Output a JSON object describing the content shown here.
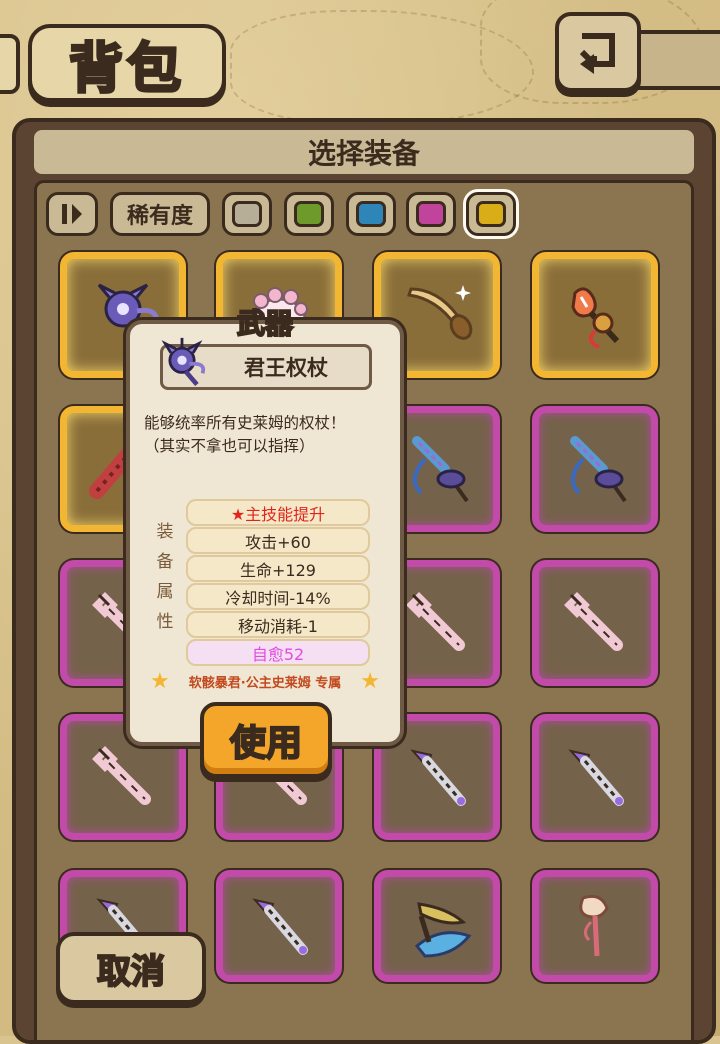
{
  "header": {
    "title": "背包"
  },
  "panel": {
    "title": "选择装备"
  },
  "filters": {
    "rarity_label": "稀有度",
    "rarity_colors": [
      "#b7ae98",
      "#6e9a2c",
      "#2e86b8",
      "#c0449b",
      "#d8ad18"
    ]
  },
  "grid": {
    "slots": [
      {
        "frame": "gold",
        "icon": "scepter-icon"
      },
      {
        "frame": "gold",
        "icon": "paw-gauntlet-icon"
      },
      {
        "frame": "gold",
        "icon": "horn-icon"
      },
      {
        "frame": "gold",
        "icon": "feather-staff-icon"
      },
      {
        "frame": "gold",
        "icon": "spiked-club-icon"
      },
      {
        "frame": "pink",
        "icon": "hidden-item-icon"
      },
      {
        "frame": "pink",
        "icon": "spiral-staff-icon"
      },
      {
        "frame": "pink",
        "icon": "spiral-staff-icon"
      },
      {
        "frame": "pink",
        "icon": "wrench-icon"
      },
      {
        "frame": "pink",
        "icon": "hidden-item-icon"
      },
      {
        "frame": "pink",
        "icon": "wrench-icon"
      },
      {
        "frame": "pink",
        "icon": "wrench-icon"
      },
      {
        "frame": "pink",
        "icon": "wrench-icon"
      },
      {
        "frame": "pink",
        "icon": "wrench-icon"
      },
      {
        "frame": "pink",
        "icon": "dagger-icon"
      },
      {
        "frame": "pink",
        "icon": "dagger-icon"
      },
      {
        "frame": "pink",
        "icon": "dagger-icon"
      },
      {
        "frame": "pink",
        "icon": "dagger-icon"
      },
      {
        "frame": "pink",
        "icon": "twin-blade-icon"
      },
      {
        "frame": "pink",
        "icon": "shell-staff-icon"
      }
    ]
  },
  "popup": {
    "category": "武器",
    "item_name": "君王权杖",
    "description_line1": "能够统率所有史莱姆的权杖！",
    "description_line2": "（其实不拿也可以指挥）",
    "attr_side_label": [
      "装",
      "备",
      "属",
      "性"
    ],
    "attributes": [
      {
        "text": "★主技能提升",
        "style": "red"
      },
      {
        "text": "攻击+60",
        "style": "normal"
      },
      {
        "text": "生命+129",
        "style": "normal"
      },
      {
        "text": "冷却时间-14%",
        "style": "normal"
      },
      {
        "text": "移动消耗-1",
        "style": "normal"
      },
      {
        "text": "自愈52",
        "style": "pink"
      }
    ],
    "exclusive_text": "软骸暴君·公主史莱姆 专属"
  },
  "buttons": {
    "use": "使用",
    "cancel": "取消"
  }
}
